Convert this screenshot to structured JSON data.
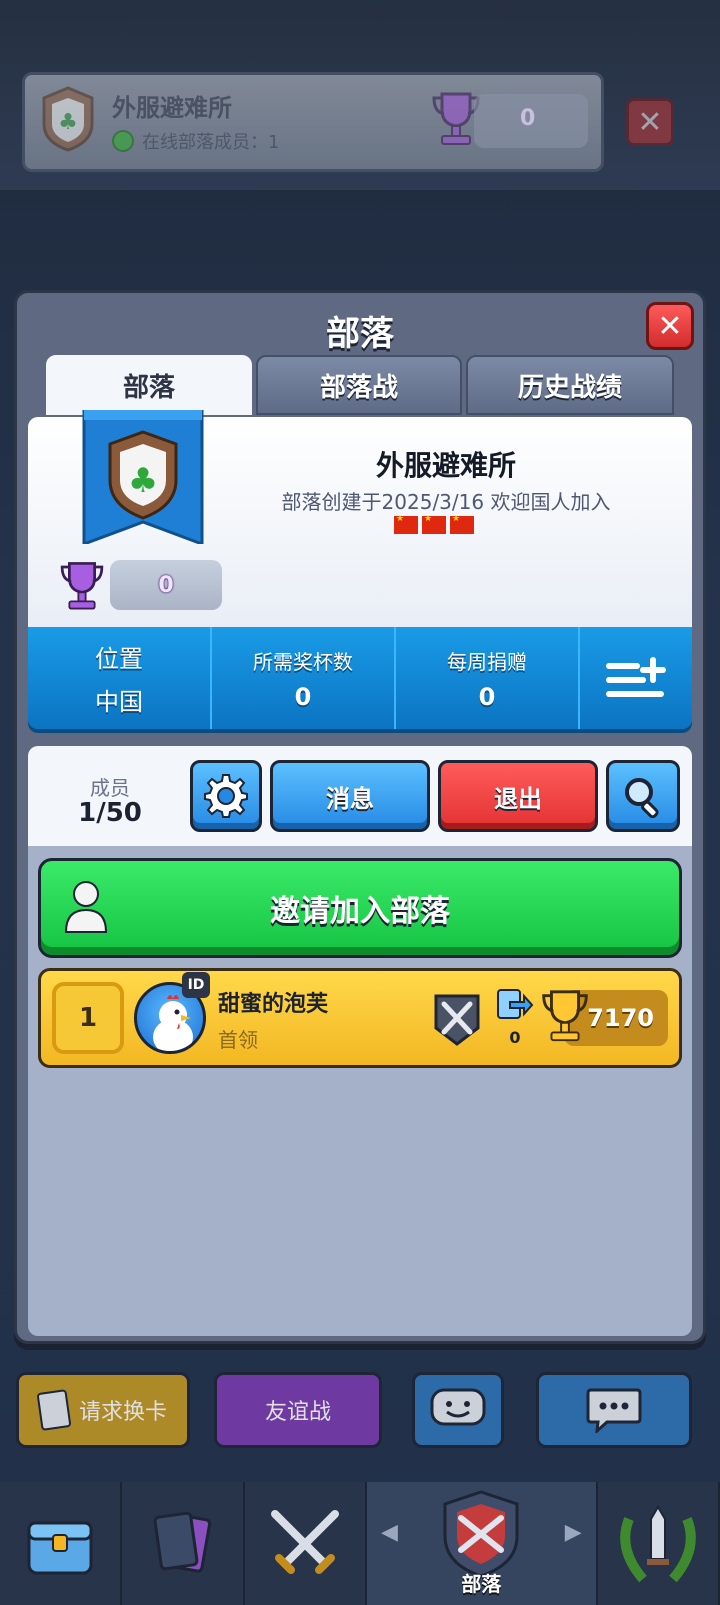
{
  "background_clan": {
    "name": "外服避难所",
    "online_text": "在线部落成员：1",
    "trophies": "0"
  },
  "panel": {
    "title": "部落",
    "tabs": [
      "部落",
      "部落战",
      "历史战绩"
    ]
  },
  "clan": {
    "name": "外服避难所",
    "description": "部落创建于2025/3/16 欢迎国人加入",
    "trophies": "0",
    "flag_icon": "cn-flag-icon"
  },
  "stats": {
    "location_label": "位置",
    "location_value": "中国",
    "required_trophies_label": "所需奖杯数",
    "required_trophies_value": "0",
    "weekly_donations_label": "每周捐赠",
    "weekly_donations_value": "0"
  },
  "members": {
    "label": "成员",
    "count": "1/50",
    "message_label": "消息",
    "exit_label": "退出",
    "invite_label": "邀请加入部落"
  },
  "member_list": [
    {
      "rank": "1",
      "id_badge": "ID",
      "name": "甜蜜的泡芙",
      "role": "首领",
      "donations": "0",
      "trophies": "7170"
    }
  ],
  "bottom_actions": {
    "request_label": "请求换卡",
    "friendly_label": "友谊战"
  },
  "nav": {
    "active_label": "部落"
  },
  "colors": {
    "stats_blue": "#0b74c2",
    "invite_green": "#14c341",
    "exit_red": "#e33232",
    "member_gold": "#f3b723"
  }
}
